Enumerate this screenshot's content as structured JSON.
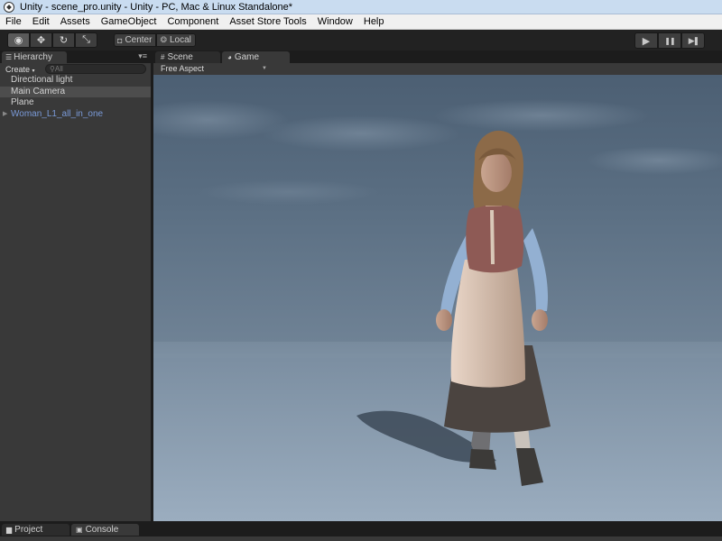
{
  "window": {
    "title": "Unity - scene_pro.unity - Unity - PC, Mac & Linux Standalone*"
  },
  "menu": [
    "File",
    "Edit",
    "Assets",
    "GameObject",
    "Component",
    "Asset Store Tools",
    "Window",
    "Help"
  ],
  "toolbar": {
    "tools": [
      {
        "name": "view-tool-button",
        "icon": "eye-icon",
        "glyph": "◉"
      },
      {
        "name": "move-tool-button",
        "icon": "move-icon",
        "glyph": "✥"
      },
      {
        "name": "rotate-tool-button",
        "icon": "rotate-icon",
        "glyph": "↻"
      },
      {
        "name": "scale-tool-button",
        "icon": "scale-icon",
        "glyph": "⤡"
      }
    ],
    "pivot_label": "Center",
    "space_label": "Local",
    "play_glyph": "▶",
    "pause_glyph": "❚❚",
    "step_glyph": "▶❚"
  },
  "hierarchy": {
    "tab_label": "Hierarchy",
    "create_label": "Create",
    "search_placeholder": "All",
    "items": [
      {
        "label": "Directional light",
        "selected": false,
        "prefab": false
      },
      {
        "label": "Main Camera",
        "selected": true,
        "prefab": false
      },
      {
        "label": "Plane",
        "selected": false,
        "prefab": false
      },
      {
        "label": "Woman_L1_all_in_one",
        "selected": false,
        "prefab": true,
        "expandable": true
      }
    ]
  },
  "game_view": {
    "scene_tab_label": "Scene",
    "game_tab_label": "Game",
    "aspect_label": "Free Aspect"
  },
  "bottom": {
    "project_tab_label": "Project",
    "console_tab_label": "Console"
  },
  "colors": {
    "editor_bg": "#393939",
    "selection": "#4d4d4d",
    "prefab_text": "#7a9ad8",
    "sky_top": "#4c5f73",
    "ground": "#8b9daf"
  }
}
